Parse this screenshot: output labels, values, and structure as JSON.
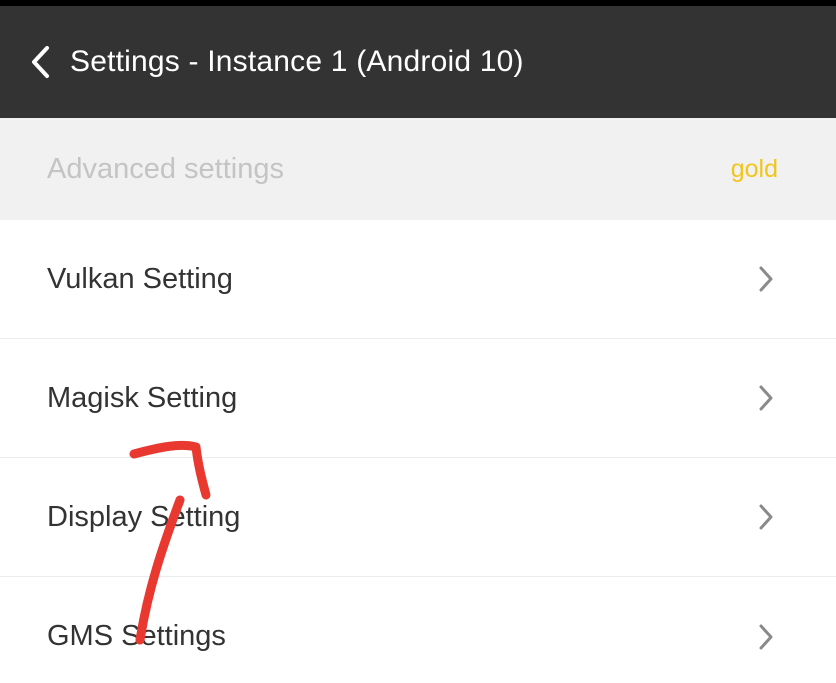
{
  "app_bar": {
    "title": "Settings - Instance 1 (Android 10)",
    "back_icon": "chevron-left-icon"
  },
  "section": {
    "title": "Advanced settings",
    "badge": "gold",
    "badge_color": "#f2c51d"
  },
  "items": [
    {
      "label": "Vulkan Setting",
      "icon": "chevron-right-icon"
    },
    {
      "label": "Magisk Setting",
      "icon": "chevron-right-icon"
    },
    {
      "label": "Display Setting",
      "icon": "chevron-right-icon"
    },
    {
      "label": "GMS Settings",
      "icon": "chevron-right-icon"
    }
  ],
  "colors": {
    "app_bar_bg": "#333333",
    "section_bg": "#f1f1f1",
    "annotation_stroke": "#e8382f"
  }
}
